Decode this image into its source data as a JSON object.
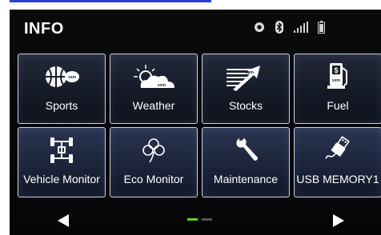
{
  "header": {
    "title": "INFO"
  },
  "status_icons": [
    "record-icon",
    "bluetooth-icon",
    "signal-bars-icon",
    "battery-icon"
  ],
  "tiles": [
    {
      "label": "Sports",
      "icon": "sports-ball-icon",
      "badge": "sxm"
    },
    {
      "label": "Weather",
      "icon": "weather-cloud-sun-icon",
      "badge": "sxm"
    },
    {
      "label": "Stocks",
      "icon": "stocks-arrow-icon",
      "badge": "sxm"
    },
    {
      "label": "Fuel",
      "icon": "fuel-pump-icon",
      "badge": "sxm"
    },
    {
      "label": "Vehicle Monitor",
      "icon": "vehicle-chassis-icon"
    },
    {
      "label": "Eco Monitor",
      "icon": "eco-clover-icon"
    },
    {
      "label": "Maintenance",
      "icon": "wrench-icon"
    },
    {
      "label": "USB MEMORY1",
      "icon": "usb-plug-icon"
    }
  ],
  "pager": {
    "pages": 2,
    "current": 1
  },
  "colors": {
    "accent_active": "#5fd400",
    "tile_border": "#c6d0e8"
  }
}
